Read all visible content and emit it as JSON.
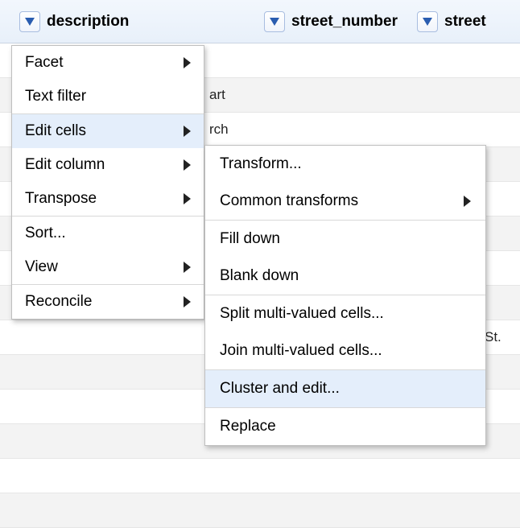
{
  "columns": {
    "description": "description",
    "street_number": "street_number",
    "street": "street"
  },
  "rows": [
    {
      "desc": "",
      "street": ""
    },
    {
      "desc": "art",
      "street": ""
    },
    {
      "desc": "rch",
      "street": ""
    },
    {
      "desc": "",
      "street": ""
    },
    {
      "desc": "",
      "street": ""
    },
    {
      "desc": "",
      "street": ""
    },
    {
      "desc": "",
      "street": ""
    },
    {
      "desc": "",
      "street": ""
    },
    {
      "desc": "",
      "street": "St."
    },
    {
      "desc": "",
      "street": ""
    },
    {
      "desc": "",
      "street": ""
    },
    {
      "desc": "",
      "street": ""
    },
    {
      "desc": "",
      "street": ""
    },
    {
      "desc": "",
      "street": ""
    }
  ],
  "menu": {
    "facet": "Facet",
    "text_filter": "Text filter",
    "edit_cells": "Edit cells",
    "edit_column": "Edit column",
    "transpose": "Transpose",
    "sort": "Sort...",
    "view": "View",
    "reconcile": "Reconcile"
  },
  "submenu": {
    "transform": "Transform...",
    "common_transforms": "Common transforms",
    "fill_down": "Fill down",
    "blank_down": "Blank down",
    "split_multi": "Split multi-valued cells...",
    "join_multi": "Join multi-valued cells...",
    "cluster_edit": "Cluster and edit...",
    "replace": "Replace"
  }
}
